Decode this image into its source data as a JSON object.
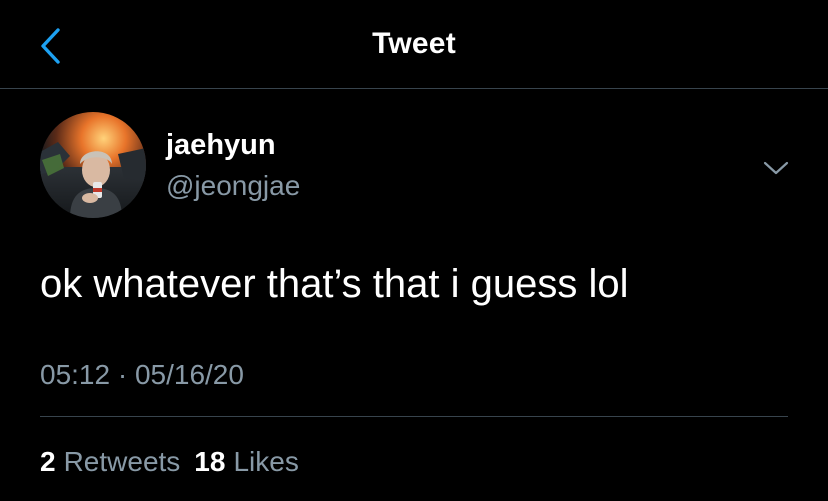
{
  "header": {
    "title": "Tweet",
    "back_icon": "chevron-left-icon"
  },
  "author": {
    "name": "jaehyun",
    "handle": "@jeongjae",
    "menu_icon": "chevron-down-icon"
  },
  "tweet": {
    "text": "ok whatever that’s that i guess lol",
    "timestamp": "05:12 · 05/16/20"
  },
  "stats": {
    "retweets_count": "2",
    "retweets_label": "Retweets",
    "likes_count": "18",
    "likes_label": "Likes"
  },
  "colors": {
    "background": "#000000",
    "accent": "#1da1f2",
    "secondary_text": "#8899a6",
    "divider": "#38444d"
  }
}
